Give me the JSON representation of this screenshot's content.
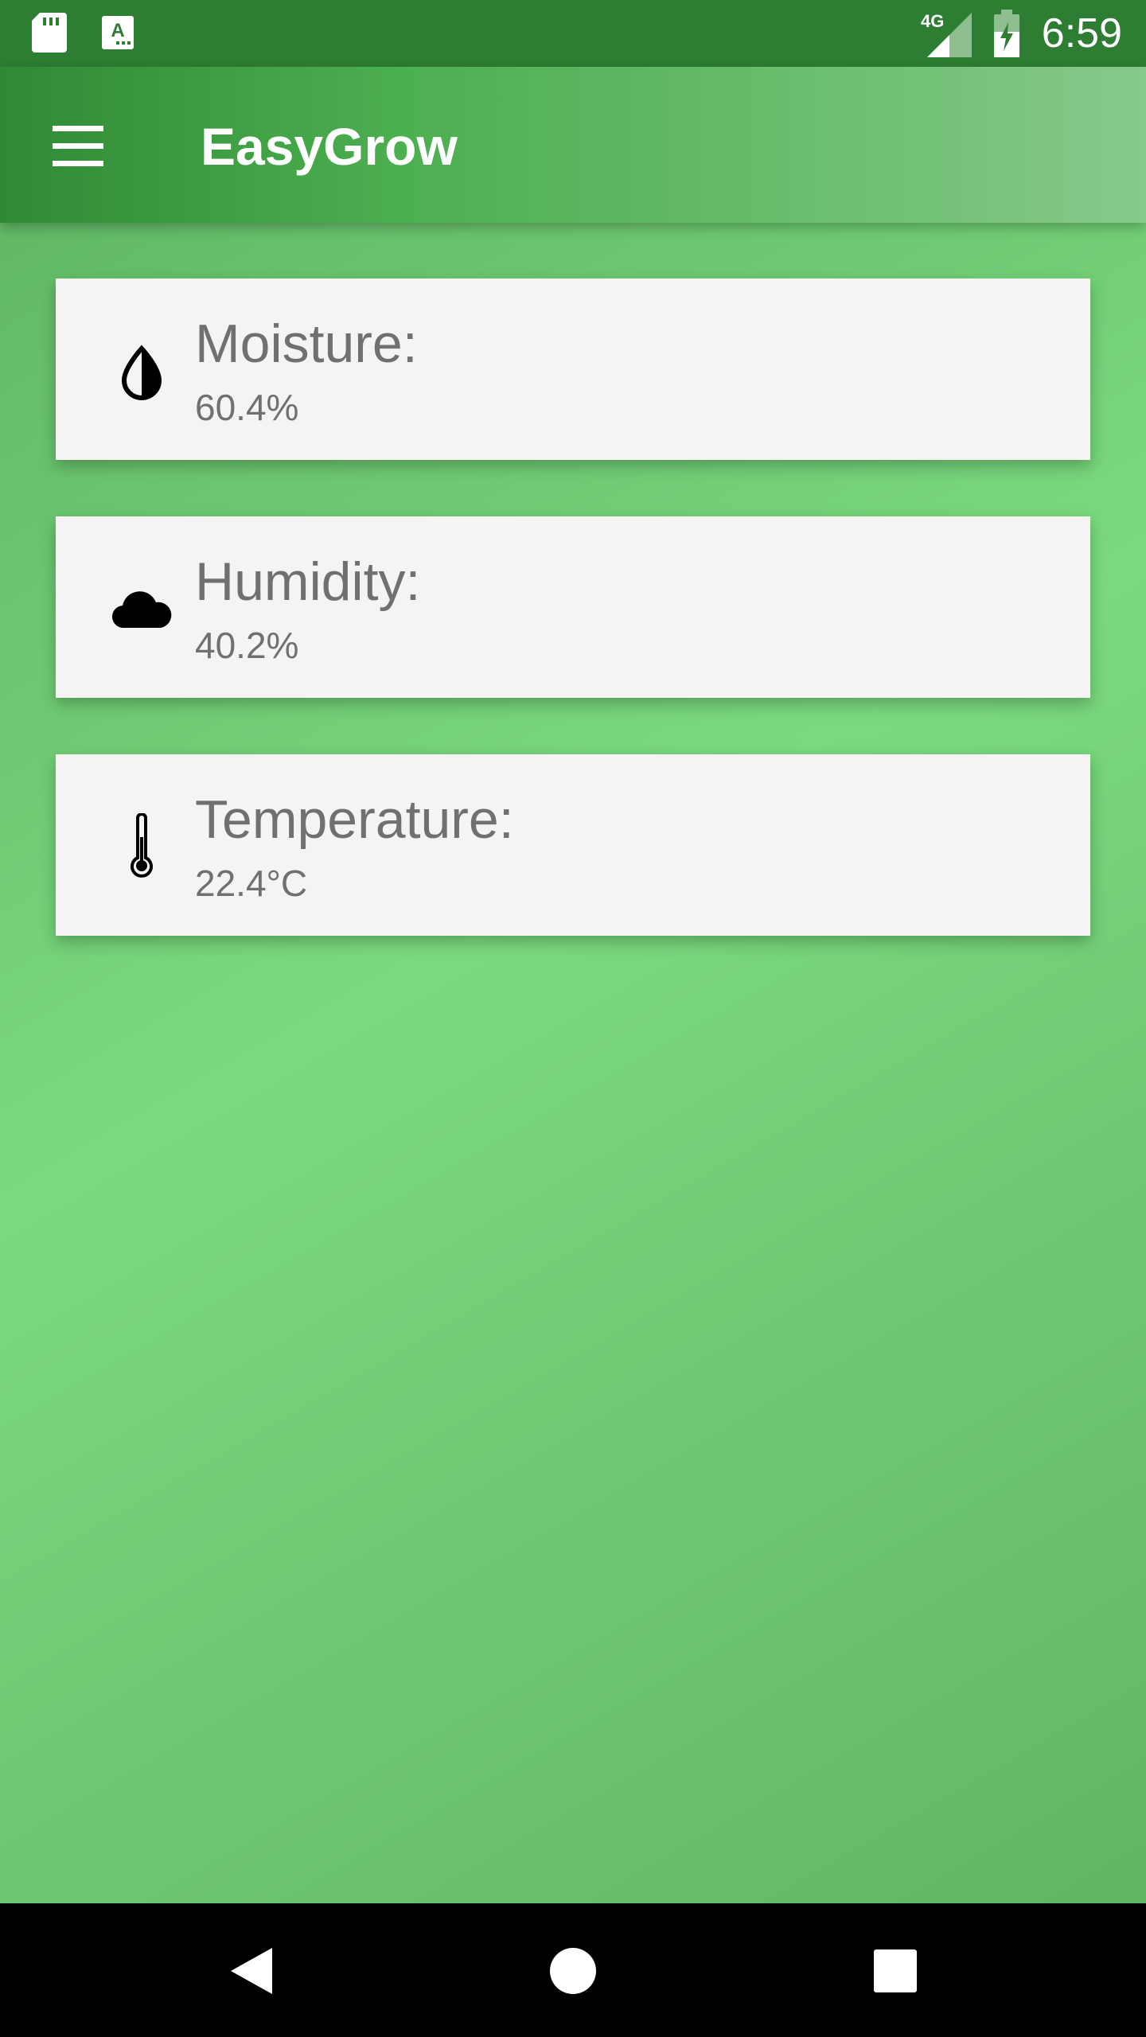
{
  "status_bar": {
    "time": "6:59",
    "network": "4G",
    "icons": [
      "sd-card-icon",
      "keyboard-icon",
      "signal-icon",
      "battery-charging-icon"
    ]
  },
  "app_bar": {
    "title": "EasyGrow",
    "menu_icon": "hamburger-menu-icon"
  },
  "sensors": [
    {
      "icon": "water-drop-icon",
      "label": "Moisture:",
      "value": "60.4%"
    },
    {
      "icon": "cloud-icon",
      "label": "Humidity:",
      "value": "40.2%"
    },
    {
      "icon": "thermometer-icon",
      "label": "Temperature:",
      "value": "22.4°C"
    }
  ],
  "nav_bar": {
    "buttons": [
      "back-icon",
      "home-icon",
      "recents-icon"
    ]
  },
  "colors": {
    "status_bar": "#2d7d32",
    "app_bar_start": "#2f8a34",
    "app_bar_end": "#86c98a",
    "background": "#7ad97e",
    "card": "#f5f3f4",
    "card_text": "#707070"
  }
}
